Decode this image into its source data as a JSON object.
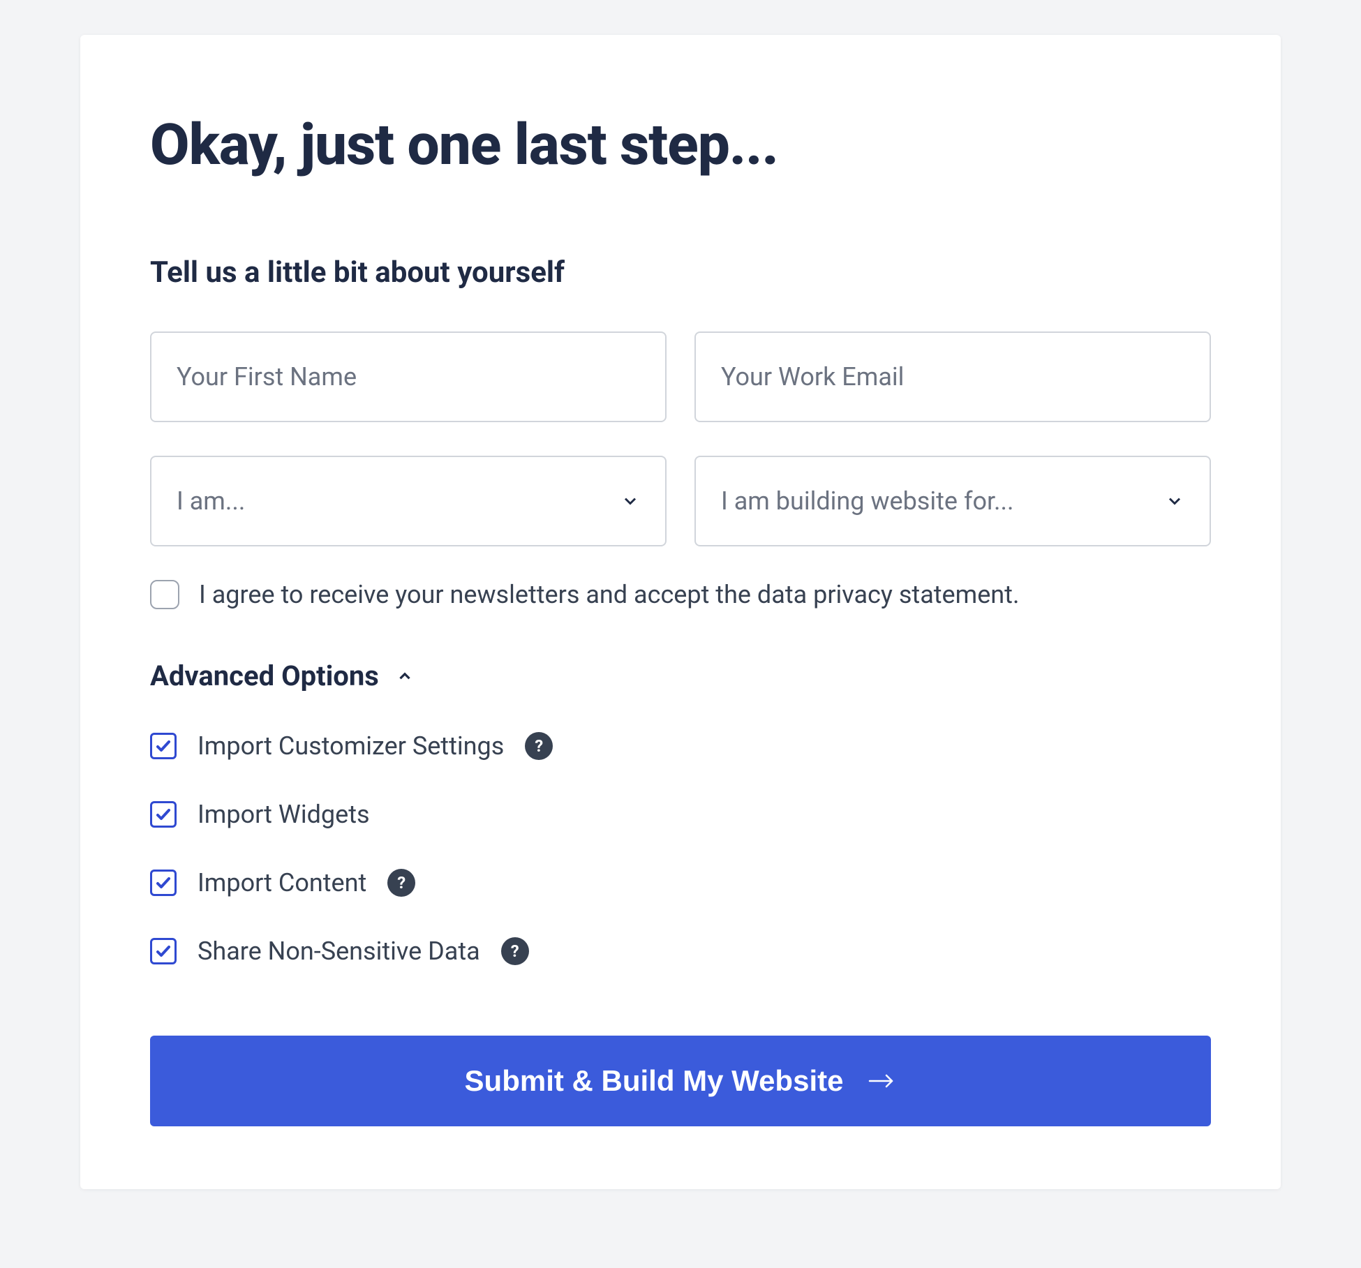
{
  "heading": "Okay, just one last step...",
  "subheading": "Tell us a little bit about yourself",
  "fields": {
    "first_name_placeholder": "Your First Name",
    "work_email_placeholder": "Your Work Email",
    "role_select_label": "I am...",
    "building_for_select_label": "I am building website for..."
  },
  "consent": {
    "label": "I agree to receive your newsletters and accept the data privacy statement.",
    "checked": false
  },
  "advanced": {
    "header": "Advanced Options",
    "options": [
      {
        "label": "Import Customizer Settings",
        "checked": true,
        "help": true
      },
      {
        "label": "Import Widgets",
        "checked": true,
        "help": false
      },
      {
        "label": "Import Content",
        "checked": true,
        "help": true
      },
      {
        "label": "Share Non-Sensitive Data",
        "checked": true,
        "help": true
      }
    ]
  },
  "submit_label": "Submit & Build My Website",
  "help_glyph": "?"
}
